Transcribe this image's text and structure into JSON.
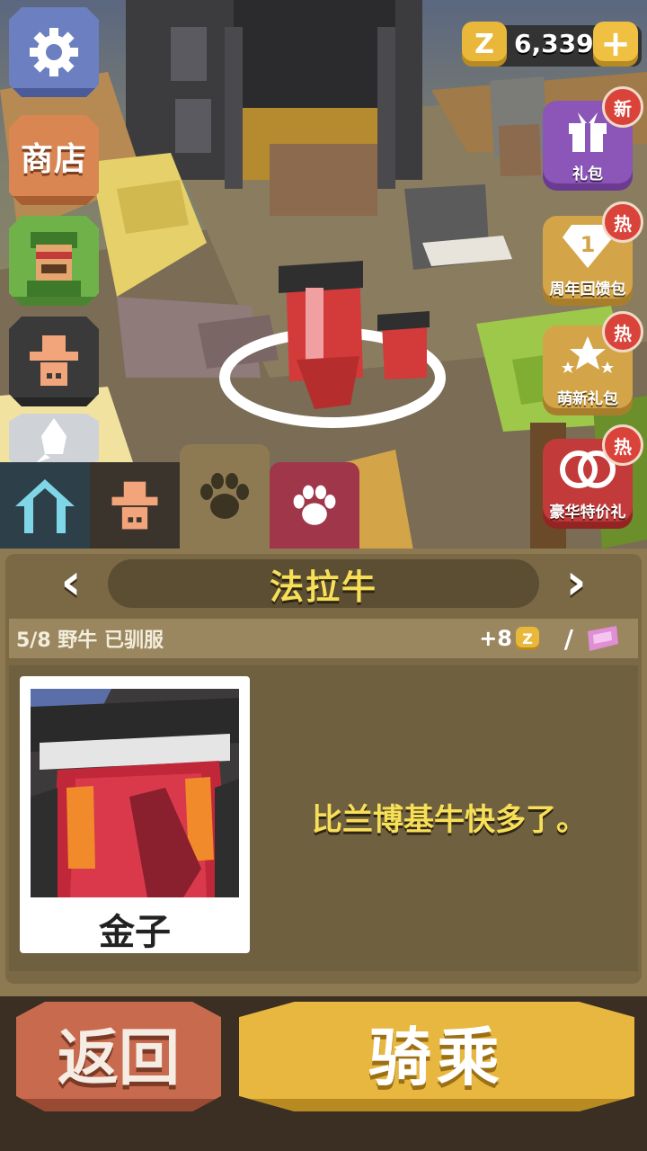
{
  "hud": {
    "coin_symbol": "Z",
    "coin_count": "6,339",
    "plus_label": "+"
  },
  "side_menu": {
    "shop_label": "商店"
  },
  "promos": [
    {
      "label": "礼包",
      "badge": "新"
    },
    {
      "label": "周年回馈包",
      "badge": "热",
      "icon_text": "1"
    },
    {
      "label": "萌新礼包",
      "badge": "热"
    },
    {
      "label": "豪华特价礼",
      "badge": "热"
    }
  ],
  "animal": {
    "name": "法拉牛",
    "tamed_status": "5/8 野牛 已驯服",
    "bonus": "+8",
    "bonus_coin_symbol": "Z",
    "separator": "/",
    "rarity": "金子",
    "description": "比兰博基牛快多了。"
  },
  "nav": {
    "prev": "‹",
    "next": "›"
  },
  "buttons": {
    "back": "返回",
    "ride": "骑乘"
  },
  "colors": {
    "title_yellow": "#f7df57",
    "panel": "#8e7a52",
    "back_button": "#c86a4e",
    "ride_button": "#e8b740",
    "promo_purple": "#8c55b8",
    "promo_gold": "#d3a548",
    "promo_red": "#c23a3a"
  }
}
